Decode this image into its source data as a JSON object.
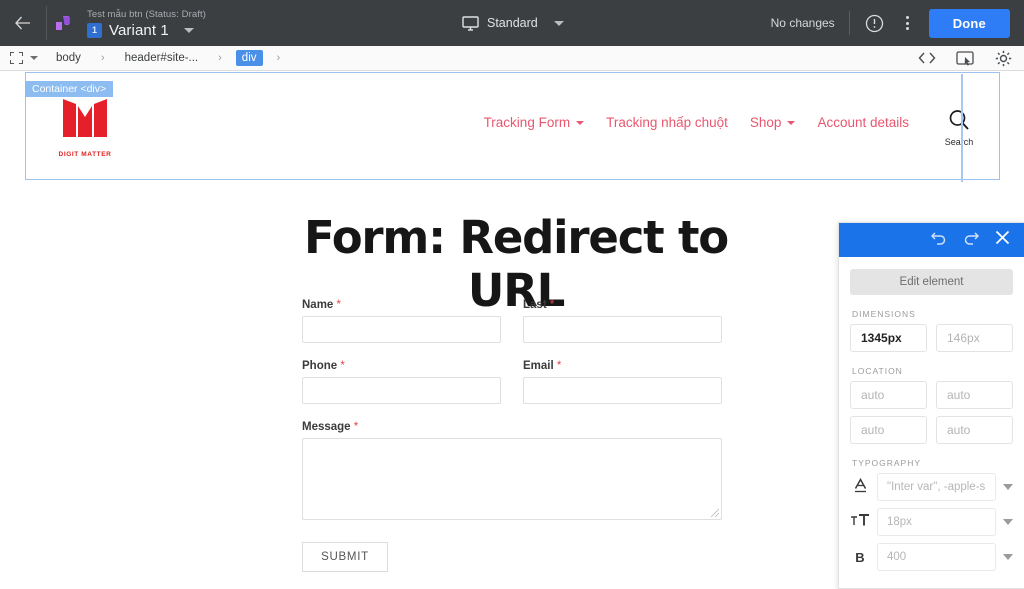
{
  "topbar": {
    "back_icon": "arrow-left-icon",
    "logo_icon": "app-logo-icon",
    "experiment_name": "Test mẫu btn (Status: Draft)",
    "variant_badge": "1",
    "variant_name": "Variant 1",
    "device_icon": "monitor-icon",
    "device_label": "Standard",
    "status_text": "No changes",
    "help_icon": "info-circle-icon",
    "more_icon": "kebab-menu-icon",
    "done_label": "Done",
    "accent_blue": "#2e7cf6",
    "bar_bg": "#3c3f41"
  },
  "breadcrumb": {
    "selector_icon": "frame-select-icon",
    "items": [
      {
        "label": "body",
        "active": false
      },
      {
        "label": "header#site-...",
        "active": false
      },
      {
        "label": "div",
        "active": true
      }
    ],
    "separator": "›",
    "tools": [
      {
        "icon": "code-brackets-icon",
        "glyph": "<>"
      },
      {
        "icon": "screen-pointer-icon",
        "glyph": ""
      },
      {
        "icon": "gear-icon",
        "glyph": ""
      }
    ]
  },
  "canvas": {
    "selection_badge": "Container <div>",
    "selection_color": "#9cc3ef",
    "site_header": {
      "logo_name": "digit-matter-logo",
      "logo_text": "DIGIT MATTER",
      "logo_color": "#e02020",
      "nav": [
        {
          "label": "Tracking Form",
          "has_caret": true
        },
        {
          "label": "Tracking nhấp chuột",
          "has_caret": false
        },
        {
          "label": "Shop",
          "has_caret": true
        },
        {
          "label": "Account details",
          "has_caret": false
        }
      ],
      "nav_color": "#e8576f",
      "search_icon": "search-icon",
      "search_label": "Search"
    },
    "page_title": "Form: Redirect to URL",
    "form": {
      "required_mark": "*",
      "rows": [
        [
          {
            "label": "Name",
            "required": true,
            "value": "",
            "type": "text"
          },
          {
            "label": "Last",
            "required": true,
            "value": "",
            "type": "text"
          }
        ],
        [
          {
            "label": "Phone",
            "required": true,
            "value": "",
            "type": "text"
          },
          {
            "label": "Email",
            "required": true,
            "value": "",
            "type": "text"
          }
        ]
      ],
      "message": {
        "label": "Message",
        "required": true,
        "value": "",
        "type": "textarea"
      },
      "submit_label": "SUBMIT"
    }
  },
  "panel": {
    "header_color": "#1a73e8",
    "undo_icon": "undo-icon",
    "redo_icon": "redo-icon",
    "close_icon": "close-icon",
    "edit_element_label": "Edit element",
    "sections": {
      "dimensions": {
        "label": "DIMENSIONS",
        "width": {
          "value": "1345px",
          "filled": true
        },
        "height": {
          "value": "146px",
          "filled": false
        }
      },
      "location": {
        "label": "LOCATION",
        "fields": [
          {
            "value": "auto"
          },
          {
            "value": "auto"
          },
          {
            "value": "auto"
          },
          {
            "value": "auto"
          }
        ]
      },
      "typography": {
        "label": "TYPOGRAPHY",
        "rows": [
          {
            "icon": "font-family-icon",
            "glyph": "A",
            "value": "\"Inter var\", -apple-s"
          },
          {
            "icon": "font-size-icon",
            "glyph": "TT",
            "value": "18px"
          },
          {
            "icon": "font-weight-icon",
            "glyph": "B",
            "value": "400"
          }
        ]
      }
    }
  }
}
